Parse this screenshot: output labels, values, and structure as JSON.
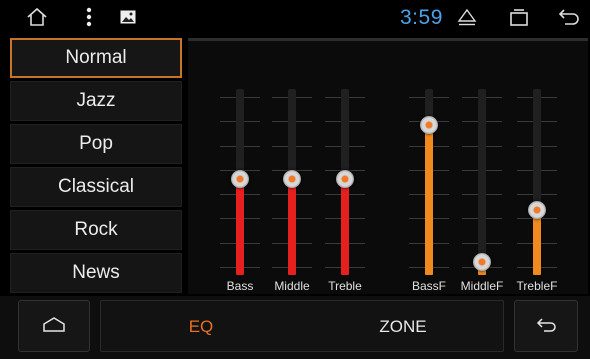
{
  "status_bar": {
    "time": "3:59",
    "icons": [
      "home-outline-icon",
      "more-vert-icon",
      "image-icon",
      "eject-icon",
      "recents-icon",
      "back-icon"
    ]
  },
  "presets": {
    "items": [
      {
        "label": "Normal",
        "selected": true
      },
      {
        "label": "Jazz",
        "selected": false
      },
      {
        "label": "Pop",
        "selected": false
      },
      {
        "label": "Classical",
        "selected": false
      },
      {
        "label": "Rock",
        "selected": false
      },
      {
        "label": "News",
        "selected": false
      }
    ]
  },
  "equalizer": {
    "sliders": [
      {
        "label": "Bass",
        "level": 0.5,
        "color": "#e5201f"
      },
      {
        "label": "Middle",
        "level": 0.5,
        "color": "#e5201f"
      },
      {
        "label": "Treble",
        "level": 0.5,
        "color": "#e5201f"
      },
      {
        "label": "BassF",
        "level": 0.8,
        "color": "#f08a1e"
      },
      {
        "label": "MiddleF",
        "level": 0.04,
        "color": "#f08a1e"
      },
      {
        "label": "TrebleF",
        "level": 0.33,
        "color": "#f08a1e"
      }
    ]
  },
  "bottom_bar": {
    "tabs": [
      {
        "label": "EQ",
        "active": true
      },
      {
        "label": "ZONE",
        "active": false
      }
    ],
    "active_color": "#e8711f",
    "home_icon": "home-outline-icon",
    "back_icon": "back-icon"
  }
}
